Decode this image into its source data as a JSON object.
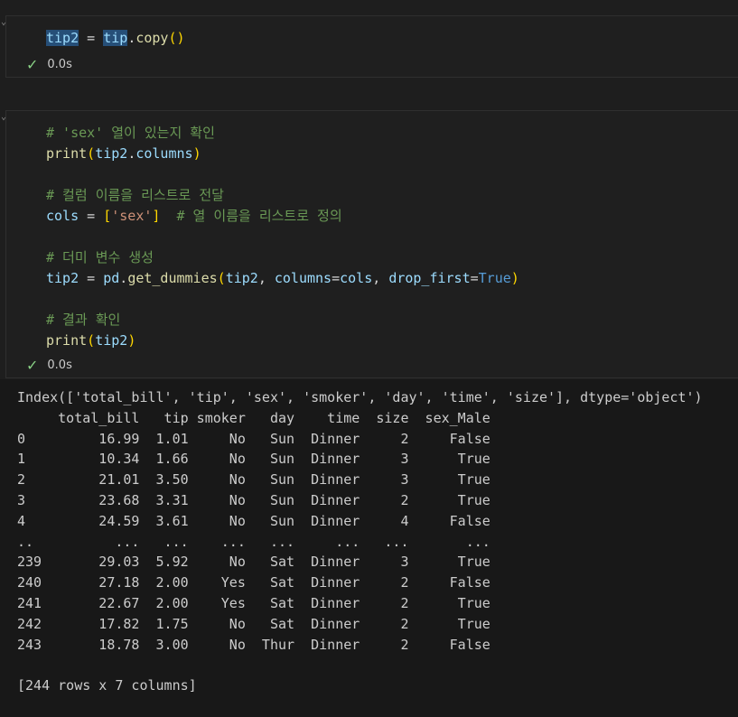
{
  "cell1": {
    "code_lines": [
      [
        {
          "t": "tip2",
          "c": "var",
          "sel": true
        },
        {
          "t": " = ",
          "c": "plain"
        },
        {
          "t": "tip",
          "c": "var",
          "sel": true
        },
        {
          "t": ".",
          "c": "plain"
        },
        {
          "t": "copy",
          "c": "fn"
        },
        {
          "t": "()",
          "c": "paren"
        }
      ]
    ],
    "status": {
      "time": "0.0s"
    }
  },
  "cell2": {
    "code_lines": [
      [
        {
          "t": "# 'sex' 열이 있는지 확인",
          "c": "comment"
        }
      ],
      [
        {
          "t": "print",
          "c": "fn"
        },
        {
          "t": "(",
          "c": "paren"
        },
        {
          "t": "tip2",
          "c": "var"
        },
        {
          "t": ".",
          "c": "plain"
        },
        {
          "t": "columns",
          "c": "var"
        },
        {
          "t": ")",
          "c": "paren"
        }
      ],
      [],
      [
        {
          "t": "# 컬럼 이름을 리스트로 전달",
          "c": "comment"
        }
      ],
      [
        {
          "t": "cols",
          "c": "var"
        },
        {
          "t": " = ",
          "c": "plain"
        },
        {
          "t": "[",
          "c": "paren"
        },
        {
          "t": "'sex'",
          "c": "str"
        },
        {
          "t": "]",
          "c": "paren"
        },
        {
          "t": "  # 열 이름을 리스트로 정의",
          "c": "comment"
        }
      ],
      [],
      [
        {
          "t": "# 더미 변수 생성",
          "c": "comment"
        }
      ],
      [
        {
          "t": "tip2",
          "c": "var"
        },
        {
          "t": " = ",
          "c": "plain"
        },
        {
          "t": "pd",
          "c": "var"
        },
        {
          "t": ".",
          "c": "plain"
        },
        {
          "t": "get_dummies",
          "c": "fn"
        },
        {
          "t": "(",
          "c": "paren"
        },
        {
          "t": "tip2",
          "c": "var"
        },
        {
          "t": ", ",
          "c": "plain"
        },
        {
          "t": "columns",
          "c": "var"
        },
        {
          "t": "=",
          "c": "plain"
        },
        {
          "t": "cols",
          "c": "var"
        },
        {
          "t": ", ",
          "c": "plain"
        },
        {
          "t": "drop_first",
          "c": "var"
        },
        {
          "t": "=",
          "c": "plain"
        },
        {
          "t": "True",
          "c": "bool"
        },
        {
          "t": ")",
          "c": "paren"
        }
      ],
      [],
      [
        {
          "t": "# 결과 확인",
          "c": "comment"
        }
      ],
      [
        {
          "t": "print",
          "c": "fn"
        },
        {
          "t": "(",
          "c": "paren"
        },
        {
          "t": "tip2",
          "c": "var"
        },
        {
          "t": ")",
          "c": "paren"
        }
      ]
    ],
    "status": {
      "time": "0.0s"
    }
  },
  "output": {
    "text": "Index(['total_bill', 'tip', 'sex', 'smoker', 'day', 'time', 'size'], dtype='object')\n     total_bill   tip smoker   day    time  size  sex_Male\n0         16.99  1.01     No   Sun  Dinner     2     False\n1         10.34  1.66     No   Sun  Dinner     3      True\n2         21.01  3.50     No   Sun  Dinner     3      True\n3         23.68  3.31     No   Sun  Dinner     2      True\n4         24.59  3.61     No   Sun  Dinner     4     False\n..          ...   ...    ...   ...     ...   ...       ...\n239       29.03  5.92     No   Sat  Dinner     3      True\n240       27.18  2.00    Yes   Sat  Dinner     2     False\n241       22.67  2.00    Yes   Sat  Dinner     2      True\n242       17.82  1.75     No   Sat  Dinner     2      True\n243       18.78  3.00     No  Thur  Dinner     2     False\n\n[244 rows x 7 columns]"
  },
  "icons": {
    "check": "✓",
    "corner": "⌄"
  }
}
